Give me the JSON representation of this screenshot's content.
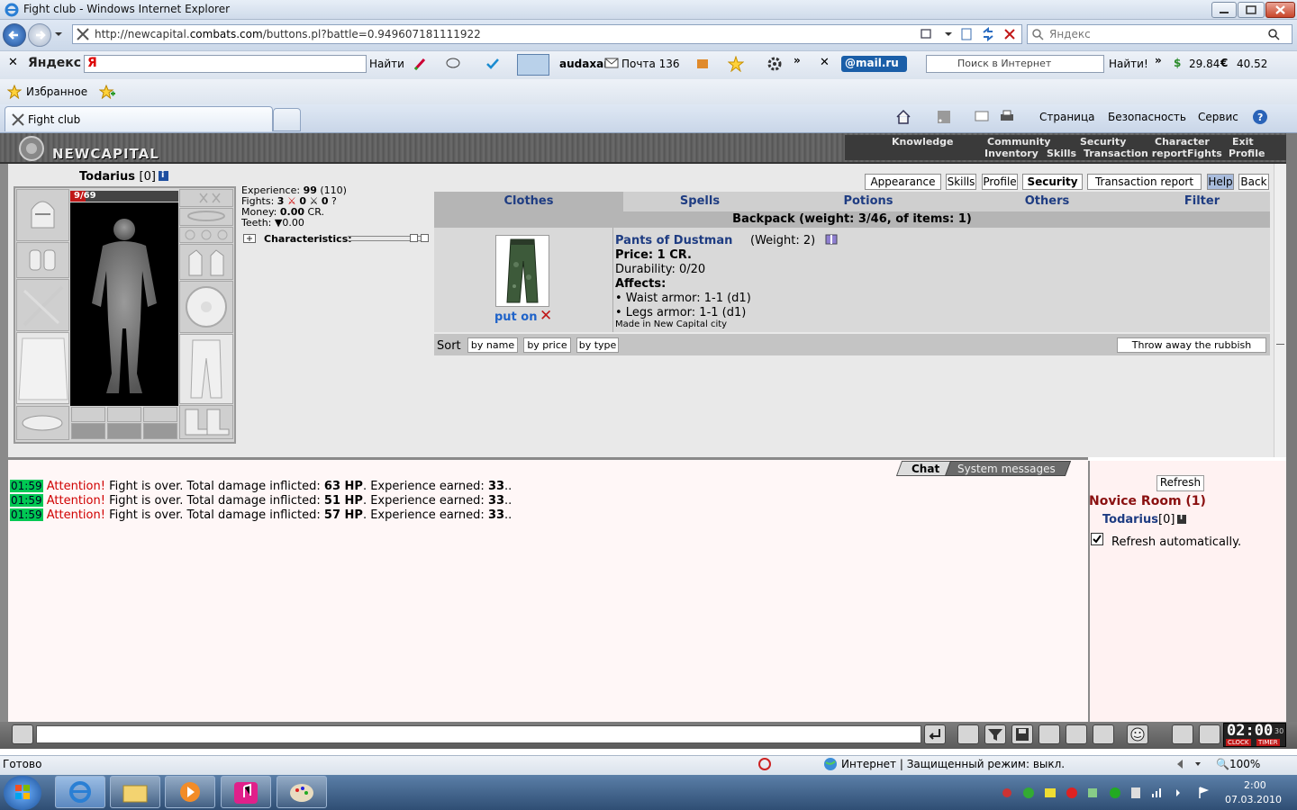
{
  "browser": {
    "window_title": "Fight club - Windows Internet Explorer",
    "url_prefix": "http://newcapital.",
    "url_domain": "combats.com",
    "url_suffix": "/buttons.pl?battle=0.949607181111922",
    "search_placeholder": "Яндекс",
    "toolbar": {
      "yandex_label": "Яндекс",
      "find_label": "Найти",
      "user_label": "audaxar",
      "mail_label": "Почта 136",
      "mailru_label": "@mail.ru",
      "search_internet_placeholder": "Поиск в Интернет",
      "find2_label": "Найти!",
      "dollar_rate": "29.84",
      "euro_rate": "40.52"
    },
    "favorites_label": "Избранное",
    "tab_label": "Fight club",
    "cmd": {
      "page": "Страница",
      "security": "Безопасность",
      "service": "Сервис"
    },
    "status_text": "Готово",
    "zone_text": "Интернет | Защищенный режим: выкл.",
    "zoom": "100%"
  },
  "game": {
    "logo": "NEWCAPITAL",
    "top_menu_row1": [
      "Knowledge",
      "Community",
      "Security",
      "Character",
      "Exit"
    ],
    "top_menu_row2": [
      "Inventory",
      "Skills",
      "Transaction report",
      "Fights",
      "Profile"
    ],
    "character": {
      "name": "Todarius",
      "level": "[0]",
      "hp": "9/69",
      "experience_label": "Experience:",
      "experience": "99",
      "experience_next": "(110)",
      "fights_label": "Fights:",
      "fights_won": "3",
      "fights_lost": "0",
      "fights_draw": "0",
      "money_label": "Money:",
      "money": "0.00",
      "money_unit": "CR.",
      "teeth_label": "Teeth:",
      "teeth": "0.00",
      "characteristics_label": "Characteristics:"
    },
    "top_buttons": [
      "Appearance",
      "Skills",
      "Profile",
      "Security",
      "Transaction report",
      "Help",
      "Back"
    ],
    "inventory_tabs": [
      "Clothes",
      "Spells",
      "Potions",
      "Others",
      "Filter"
    ],
    "backpack_header": "Backpack (weight: 3/46, of items: 1)",
    "item": {
      "name": "Pants of Dustman",
      "weight": "(Weight: 2)",
      "price": "Price: 1 CR.",
      "durability": "Durability: 0/20",
      "affects_label": "Affects:",
      "affect1": "• Waist armor: 1-1 (d1)",
      "affect2": "• Legs armor: 1-1 (d1)",
      "made_in": "Made in New Capital city",
      "put_on": "put on"
    },
    "sort": {
      "label": "Sort",
      "by_name": "by name",
      "by_price": "by price",
      "by_type": "by type",
      "throw": "Throw away the rubbish"
    },
    "chat": {
      "tab_chat": "Chat",
      "tab_system": "System messages",
      "messages": [
        {
          "time": "01:59",
          "attn": "Attention!",
          "text1": " Fight is over. Total damage inflicted: ",
          "dmg": "63 HP",
          "text2": ". Experience earned: ",
          "exp": "33",
          "end": ".."
        },
        {
          "time": "01:59",
          "attn": "Attention!",
          "text1": " Fight is over. Total damage inflicted: ",
          "dmg": "51 HP",
          "text2": ". Experience earned: ",
          "exp": "33",
          "end": ".."
        },
        {
          "time": "01:59",
          "attn": "Attention!",
          "text1": " Fight is over. Total damage inflicted: ",
          "dmg": "57 HP",
          "text2": ". Experience earned: ",
          "exp": "33",
          "end": ".."
        }
      ]
    },
    "room": {
      "refresh": "Refresh",
      "title": "Novice Room (1)",
      "member": "Todarius",
      "member_level": "[0]",
      "auto_refresh": "Refresh automatically."
    },
    "clock": "02:00",
    "clock_sec": "30",
    "clock_label": "CLOCK",
    "timer_label": "TIMER"
  },
  "taskbar": {
    "time": "2:00",
    "date": "07.03.2010"
  }
}
